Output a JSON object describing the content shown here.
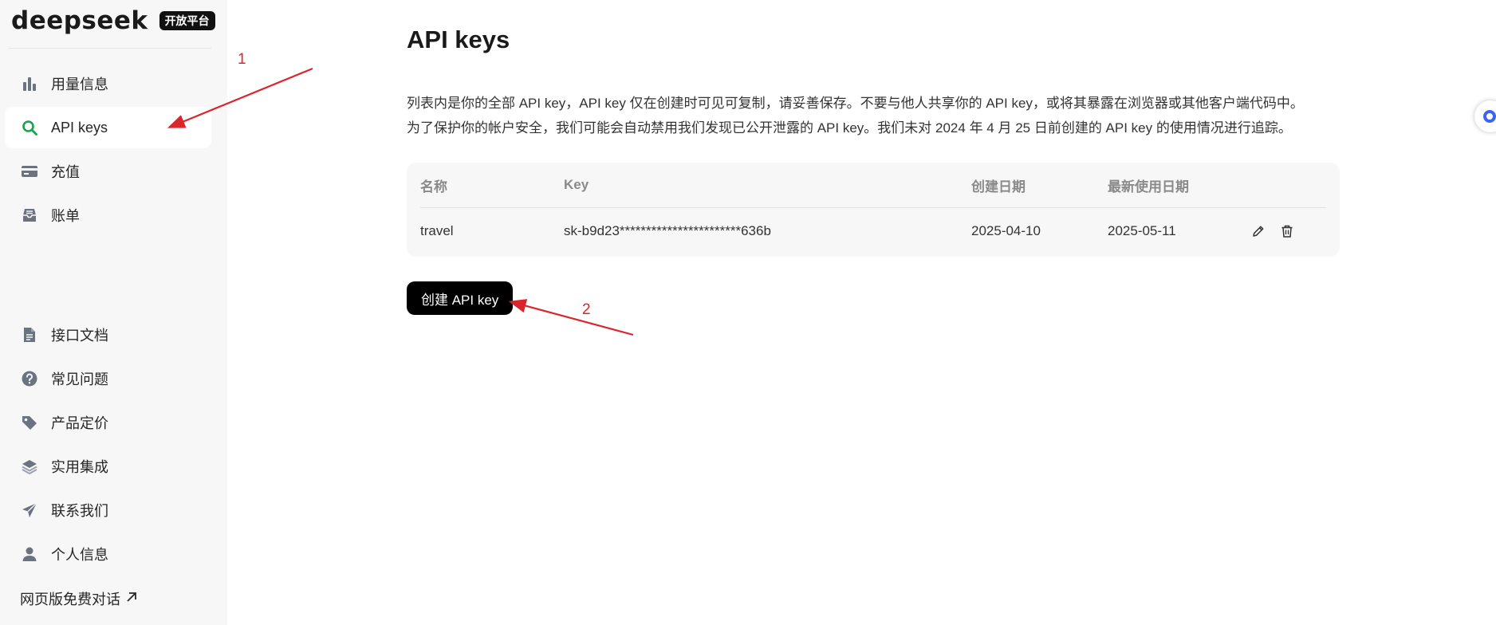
{
  "brand": {
    "logo_text": "deepseek",
    "badge": "开放平台"
  },
  "sidebar": {
    "items": [
      {
        "label": "用量信息",
        "icon": "bar-chart-icon",
        "active": false
      },
      {
        "label": "API keys",
        "icon": "search-icon",
        "active": true
      },
      {
        "label": "充值",
        "icon": "card-icon",
        "active": false
      },
      {
        "label": "账单",
        "icon": "inbox-icon",
        "active": false
      }
    ],
    "bottom_items": [
      {
        "label": "接口文档",
        "icon": "document-icon"
      },
      {
        "label": "常见问题",
        "icon": "question-icon"
      },
      {
        "label": "产品定价",
        "icon": "tag-icon"
      },
      {
        "label": "实用集成",
        "icon": "layers-icon"
      },
      {
        "label": "联系我们",
        "icon": "send-icon"
      },
      {
        "label": "个人信息",
        "icon": "user-icon"
      }
    ],
    "web_chat": "网页版免费对话",
    "web_chat_icon": "external-arrow-icon"
  },
  "main": {
    "title": "API keys",
    "description_line1": "列表内是你的全部 API key，API key 仅在创建时可见可复制，请妥善保存。不要与他人共享你的 API key，或将其暴露在浏览器或其他客户端代码中。",
    "description_line2": "为了保护你的帐户安全，我们可能会自动禁用我们发现已公开泄露的 API key。我们未对 2024 年 4 月 25 日前创建的 API key 的使用情况进行追踪。",
    "table": {
      "headers": {
        "name": "名称",
        "key": "Key",
        "created": "创建日期",
        "last_used": "最新使用日期"
      },
      "rows": [
        {
          "name": "travel",
          "key": "sk-b9d23***********************636b",
          "created": "2025-04-10",
          "last_used": "2025-05-11"
        }
      ]
    },
    "create_button": "创建 API key"
  },
  "annotations": {
    "label_1": "1",
    "label_2": "2",
    "color": "#d9262c"
  },
  "colors": {
    "accent_green": "#16a34a",
    "sidebar_bg": "#f7f7f8",
    "button_bg": "#000000"
  }
}
